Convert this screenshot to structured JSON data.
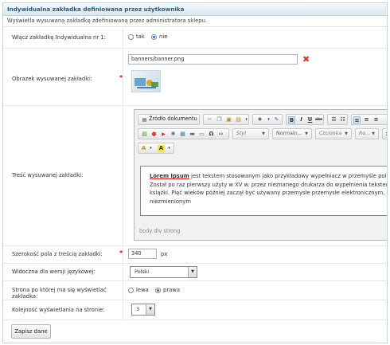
{
  "panel": {
    "title": "Indywidualna zakładka definiowana przez użytkownika",
    "description": "Wyświetla wysuwaną zakładkę zdefiniowaną przez administratora sklepu."
  },
  "fields": {
    "enable": {
      "label": "Włącz zakładkę Indywidualna nr 1:",
      "options": [
        "tak",
        "nie"
      ],
      "selected": "nie"
    },
    "image": {
      "label": "Obrazek wysuwanej zakładki:",
      "value": "banners/banner.png"
    },
    "content": {
      "label": "Treść wysuwanej zakładki:"
    },
    "width": {
      "label": "Szerokość pola z treścią zakładki:",
      "value": "340",
      "unit": "px"
    },
    "visibility": {
      "label": "Widoczna dla wersji językowej:",
      "value": "Polski"
    },
    "side": {
      "label": "Strona po której ma się wyświetlać zakładka:",
      "options": [
        "lewa",
        "prawa"
      ],
      "selected": "prawa"
    },
    "order": {
      "label": "Kolejność wyświetlania na stronie:",
      "value": "3"
    }
  },
  "editor": {
    "source_label": "Źródło dokumentu",
    "style_combo": "Styl",
    "format_combo": "Normaln...",
    "font_combo": "Czcionka",
    "size_combo": "Ro...",
    "content_bold": "Lorem Ipsum",
    "content_lines": [
      " jest tekstem stosowanym jako przykładowy wypełniacz w przemyśle poli",
      "Został po raz pierwszy użyty w XV w. przez nieznanego drukarza do wypełnienia tekstem",
      "książki. Pięć wieków później zaczął być używany przemysłe przemysłe elektronicznym, pozostając",
      "niezmienionym"
    ],
    "path": "body  div  strong"
  },
  "save_label": "Zapisz dane",
  "colors": {
    "header": "#2d5b7f",
    "required": "#cc0000",
    "delete": "#d63a2a"
  }
}
